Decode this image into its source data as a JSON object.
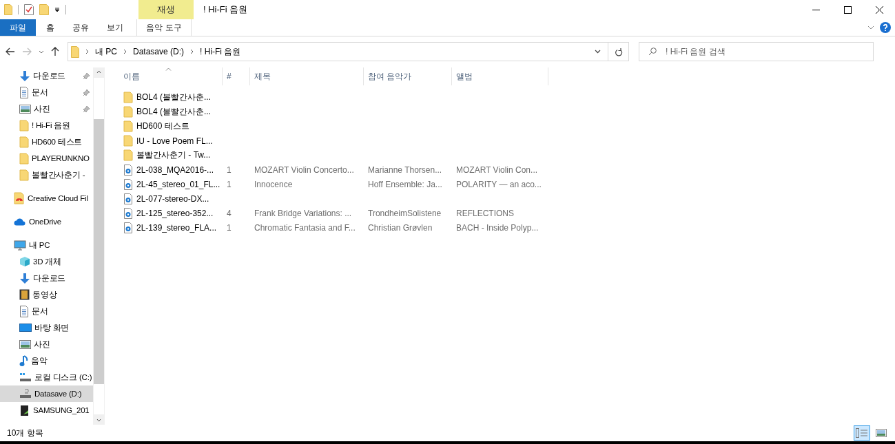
{
  "window": {
    "title": "! Hi-Fi 음원"
  },
  "ribbon": {
    "context_group": "재생",
    "tabs": [
      {
        "label": "파일",
        "kind": "file",
        "selected": false
      },
      {
        "label": "홈",
        "kind": "normal",
        "selected": false
      },
      {
        "label": "공유",
        "kind": "normal",
        "selected": false
      },
      {
        "label": "보기",
        "kind": "normal",
        "selected": false
      },
      {
        "label": "음악 도구",
        "kind": "contextual",
        "selected": false
      }
    ]
  },
  "address": {
    "path": [
      "내 PC",
      "Datasave (D:)",
      "! Hi-Fi 음원"
    ]
  },
  "search": {
    "placeholder": "! Hi-Fi 음원 검색"
  },
  "sidebar": {
    "quick_access": [
      {
        "label": "다운로드",
        "kind": "download",
        "pinned": true,
        "selected": false
      },
      {
        "label": "문서",
        "kind": "document",
        "pinned": true,
        "selected": false
      },
      {
        "label": "사진",
        "kind": "pictures",
        "pinned": true,
        "selected": false
      },
      {
        "label": "! Hi-Fi 음원",
        "kind": "folder",
        "pinned": false,
        "selected": false
      },
      {
        "label": "HD600 테스트",
        "kind": "folder",
        "pinned": false,
        "selected": false
      },
      {
        "label": "PLAYERUNKNO",
        "kind": "folder",
        "pinned": false,
        "selected": false
      },
      {
        "label": "볼빨간사춘기 -",
        "kind": "folder",
        "pinned": false,
        "selected": false
      }
    ],
    "locations": [
      {
        "label": "Creative Cloud Fil",
        "kind": "cloud-files",
        "selected": false
      },
      {
        "label": "OneDrive",
        "kind": "onedrive",
        "selected": false
      },
      {
        "label": "내 PC",
        "kind": "pc",
        "selected": false,
        "children": [
          {
            "label": "3D 개체",
            "kind": "cube",
            "selected": false
          },
          {
            "label": "다운로드",
            "kind": "download",
            "selected": false
          },
          {
            "label": "동영상",
            "kind": "video",
            "selected": false
          },
          {
            "label": "문서",
            "kind": "document",
            "selected": false
          },
          {
            "label": "바탕 화면",
            "kind": "desktop",
            "selected": false
          },
          {
            "label": "사진",
            "kind": "pictures",
            "selected": false
          },
          {
            "label": "음악",
            "kind": "music",
            "selected": false
          },
          {
            "label": "로컬 디스크 (C:)",
            "kind": "system-drive",
            "selected": false
          },
          {
            "label": "Datasave (D:)",
            "kind": "drive",
            "selected": true
          },
          {
            "label": "SAMSUNG_201",
            "kind": "usb-drive",
            "selected": false
          }
        ]
      }
    ]
  },
  "table": {
    "columns": [
      {
        "label": "이름",
        "sorted": true
      },
      {
        "label": "#",
        "sorted": false
      },
      {
        "label": "제목",
        "sorted": false
      },
      {
        "label": "참여 음악가",
        "sorted": false
      },
      {
        "label": "앨범",
        "sorted": false
      }
    ],
    "rows": [
      {
        "kind": "folder",
        "name": "BOL4 (볼빨간사춘..."
      },
      {
        "kind": "folder",
        "name": "BOL4 (볼빨간사춘..."
      },
      {
        "kind": "folder",
        "name": "HD600 테스트"
      },
      {
        "kind": "folder",
        "name": "IU - Love Poem FL..."
      },
      {
        "kind": "folder",
        "name": "볼빨간사춘기 - Tw..."
      },
      {
        "kind": "audio",
        "name": "2L-038_MQA2016-...",
        "number": "1",
        "title": "MOZART Violin Concerto...",
        "artists": "Marianne Thorsen...",
        "album": "MOZART Violin Con..."
      },
      {
        "kind": "audio",
        "name": "2L-45_stereo_01_FL...",
        "number": "1",
        "title": "Innocence",
        "artists": "Hoff Ensemble: Ja...",
        "album": "POLARITY — an aco..."
      },
      {
        "kind": "audio",
        "name": "2L-077-stereo-DX..."
      },
      {
        "kind": "audio",
        "name": "2L-125_stereo-352...",
        "number": "4",
        "title": "Frank Bridge Variations: ...",
        "artists": "TrondheimSolistene",
        "album": "REFLECTIONS"
      },
      {
        "kind": "audio",
        "name": "2L-139_stereo_FLA...",
        "number": "1",
        "title": "Chromatic Fantasia and F...",
        "artists": "Christian Grøvlen",
        "album": "BACH - Inside Polyp..."
      }
    ]
  },
  "status_bar": {
    "item_count": "10개 항목",
    "views": [
      {
        "kind": "details",
        "selected": true
      },
      {
        "kind": "large-icons",
        "selected": false
      }
    ]
  }
}
